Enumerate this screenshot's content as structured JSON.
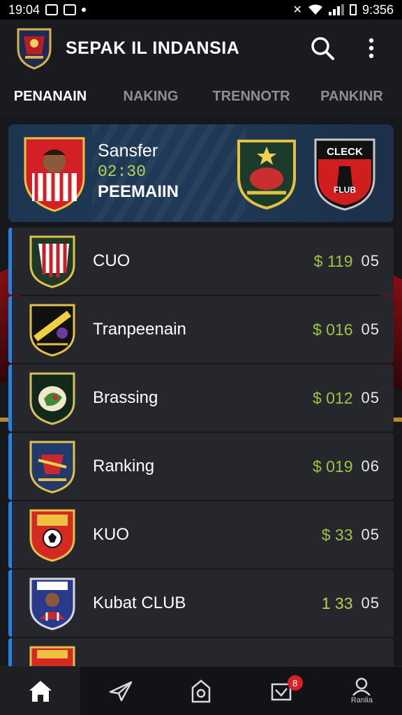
{
  "status_bar": {
    "time_left": "19:04",
    "time_right": "9:356"
  },
  "header": {
    "title": "SEPAK IL INDANSIA",
    "logo_icon": "club-crest-icon",
    "search_icon": "search-icon",
    "menu_icon": "more-vertical-icon"
  },
  "tabs": [
    {
      "label": "PENANAIN",
      "active": true
    },
    {
      "label": "NAKING",
      "active": false
    },
    {
      "label": "TRENNOTR",
      "active": false
    },
    {
      "label": "PANKINR",
      "active": false
    }
  ],
  "featured": {
    "name": "Sansfer",
    "time": "02:30",
    "subtitle": "PEEMAIIN",
    "club_badge_text": "CLECK",
    "club_badge_text2": "FLUB"
  },
  "rows": [
    {
      "name": "CUO",
      "value": "$ 119",
      "count": "05",
      "crest": "red-white-stripes"
    },
    {
      "name": "Tranpeenain",
      "value": "$ 016",
      "count": "05",
      "crest": "black-yellow"
    },
    {
      "name": "Brassing",
      "value": "$ 012",
      "count": "05",
      "crest": "green-black"
    },
    {
      "name": "Ranking",
      "value": "$ 019",
      "count": "06",
      "crest": "blue-gold"
    },
    {
      "name": "KUO",
      "value": "$ 33",
      "count": "05",
      "crest": "red-ball"
    },
    {
      "name": "Kubat CLUB",
      "value": "1 33",
      "count": "05",
      "crest": "blue-red-player"
    }
  ],
  "bottom_nav": {
    "items": [
      "home-icon",
      "send-icon",
      "shop-icon",
      "inbox-icon",
      "profile-icon"
    ],
    "badge_count": "8",
    "profile_label": "Ranlia"
  },
  "colors": {
    "accent_blue": "#2f7fd4",
    "value_green": "#9cc444",
    "badge_red": "#d92124"
  }
}
